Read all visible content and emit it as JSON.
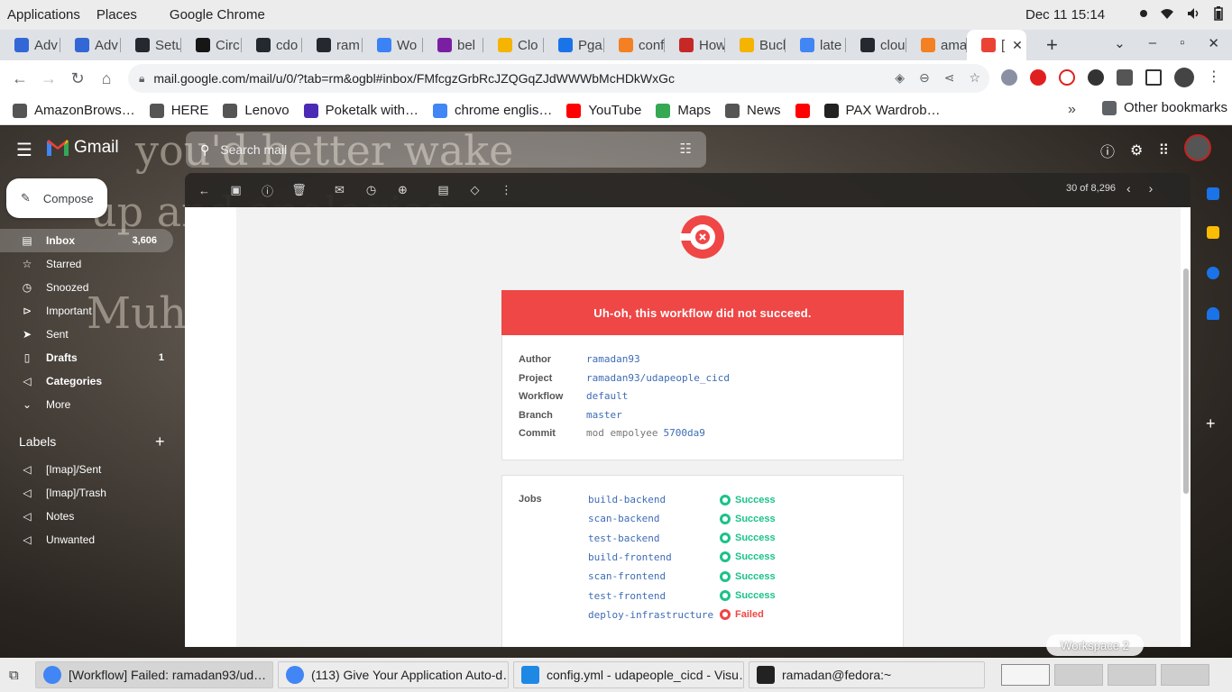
{
  "topbar": {
    "applications": "Applications",
    "places": "Places",
    "app_name": "Google Chrome",
    "clock": "Dec 11  15:14"
  },
  "tabs": [
    {
      "label": "Adv",
      "favicon": "#3367d6"
    },
    {
      "label": "Adv",
      "favicon": "#3367d6"
    },
    {
      "label": "Setu",
      "favicon": "#24292f"
    },
    {
      "label": "Circ",
      "favicon": "#161616"
    },
    {
      "label": "cdo",
      "favicon": "#24292f"
    },
    {
      "label": "ram",
      "favicon": "#24292f"
    },
    {
      "label": "Wo",
      "favicon": "#3b82f6"
    },
    {
      "label": "bel",
      "favicon": "#7b1fa2"
    },
    {
      "label": "Clo",
      "favicon": "#f4b400"
    },
    {
      "label": "Pga",
      "favicon": "#1a73e8"
    },
    {
      "label": "conf",
      "favicon": "#f48024"
    },
    {
      "label": "How",
      "favicon": "#c62828"
    },
    {
      "label": "Buck",
      "favicon": "#f4b400"
    },
    {
      "label": "late",
      "favicon": "#4285f4"
    },
    {
      "label": "clou",
      "favicon": "#24292f"
    },
    {
      "label": "ama",
      "favicon": "#f48024"
    },
    {
      "label": "[",
      "favicon": "#ea4335",
      "active": true
    }
  ],
  "address_bar": {
    "url": "mail.google.com/mail/u/0/?tab=rm&ogbl#inbox/FMfcgzGrbRcJZQGqZJdWWWbMcHDkWxGc"
  },
  "bookmarks": [
    {
      "label": "AmazonBrows…",
      "icon": "#555"
    },
    {
      "label": "HERE",
      "icon": "#555"
    },
    {
      "label": "Lenovo",
      "icon": "#555"
    },
    {
      "label": "Poketalk with…",
      "icon": "#4b2bb5"
    },
    {
      "label": "chrome englis…",
      "icon": "#4285f4"
    },
    {
      "label": "YouTube",
      "icon": "#ff0000"
    },
    {
      "label": "Maps",
      "icon": "#34a853"
    },
    {
      "label": "News",
      "icon": "#555"
    },
    {
      "label": "",
      "icon": "#ff0000"
    },
    {
      "label": "PAX Wardrob…",
      "icon": "#222"
    }
  ],
  "bookmarks_other": "Other bookmarks",
  "gmail": {
    "logo_text": "Gmail",
    "search_placeholder": "Search mail",
    "compose": "Compose",
    "nav": [
      {
        "label": "Inbox",
        "count": "3,606",
        "icon": "inbox-icon",
        "active": true
      },
      {
        "label": "Starred",
        "count": "",
        "icon": "star-icon"
      },
      {
        "label": "Snoozed",
        "count": "",
        "icon": "clock-icon"
      },
      {
        "label": "Important",
        "count": "",
        "icon": "important-icon"
      },
      {
        "label": "Sent",
        "count": "",
        "icon": "send-icon"
      },
      {
        "label": "Drafts",
        "count": "1",
        "icon": "draft-icon",
        "bold": true
      },
      {
        "label": "Categories",
        "count": "",
        "icon": "label-icon",
        "bold": true
      },
      {
        "label": "More",
        "count": "",
        "icon": "chevron-down-icon"
      }
    ],
    "labels_header": "Labels",
    "labels": [
      "[Imap]/Sent",
      "[Imap]/Trash",
      "Notes",
      "Unwanted"
    ],
    "pager": "30 of 8,296",
    "background_text": [
      "you'd better wake",
      "up and apologise",
      "Muha"
    ]
  },
  "email": {
    "banner": "Uh-oh, this workflow did not succeed.",
    "meta": [
      {
        "key": "Author",
        "value": "ramadan93"
      },
      {
        "key": "Project",
        "value": "ramadan93/udapeople_cicd"
      },
      {
        "key": "Workflow",
        "value": "default"
      },
      {
        "key": "Branch",
        "value": "master"
      },
      {
        "key": "Commit",
        "muted": "mod empolyee",
        "value": "5700da9"
      }
    ],
    "jobs_label": "Jobs",
    "jobs": [
      {
        "name": "build-backend",
        "status": "Success"
      },
      {
        "name": "scan-backend",
        "status": "Success"
      },
      {
        "name": "test-backend",
        "status": "Success"
      },
      {
        "name": "build-frontend",
        "status": "Success"
      },
      {
        "name": "scan-frontend",
        "status": "Success"
      },
      {
        "name": "test-frontend",
        "status": "Success"
      },
      {
        "name": "deploy-infrastructure",
        "status": "Failed"
      }
    ],
    "colors": {
      "success": "#1bc289",
      "failed": "#ef4646",
      "banner": "#ef4646",
      "link": "#3d6cb5"
    }
  },
  "workspace_tip": "Workspace 2",
  "taskbar": [
    {
      "label": "[Workflow] Failed: ramadan93/ud…",
      "icon": "chrome",
      "active": true
    },
    {
      "label": "(113) Give Your Application Auto-d…",
      "icon": "chrome"
    },
    {
      "label": "config.yml - udapeople_cicd - Visu…",
      "icon": "vscode"
    },
    {
      "label": "ramadan@fedora:~",
      "icon": "terminal"
    }
  ]
}
